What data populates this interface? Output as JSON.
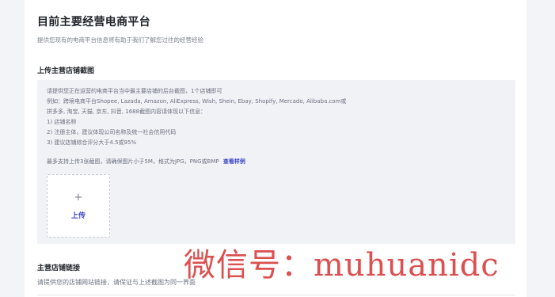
{
  "header": {
    "title": "目前主要经营电商平台",
    "subtitle": "提供您现有的电商平台信息将有助于我们了解您过往的经营经验"
  },
  "upload_section": {
    "title": "上传主营店铺截图",
    "info_lines": [
      "请提供您正在运营的电商平台当中最主要店铺的后台截图，1个店铺即可",
      "例如：跨境电商平台Shopee, Lazada, Amazon, AliExpress, Wish, Shein, Ebay, Shopify, Mercado, Alibaba.com或",
      "拼多多, 淘宝, 天猫, 京东, 抖音, 1688截图内容请体现以下信息：",
      "1) 店铺名称",
      "2) 注册主体，建议体现公司名称及统一社会信用代码",
      "3) 建议店铺综合评分大于4.5或95%"
    ],
    "limit_text": "最多支持上传3张截图，请确保图片小于5M，格式为JPG，PNG或BMP",
    "sample_link": "查看样例",
    "upload_plus": "+",
    "upload_label": "上传"
  },
  "link_section": {
    "title": "主营店铺链接",
    "description": "请提供您的店铺网站链接，请保证与上述截图为同一界面"
  },
  "watermark": "微信号：muhuanidc"
}
